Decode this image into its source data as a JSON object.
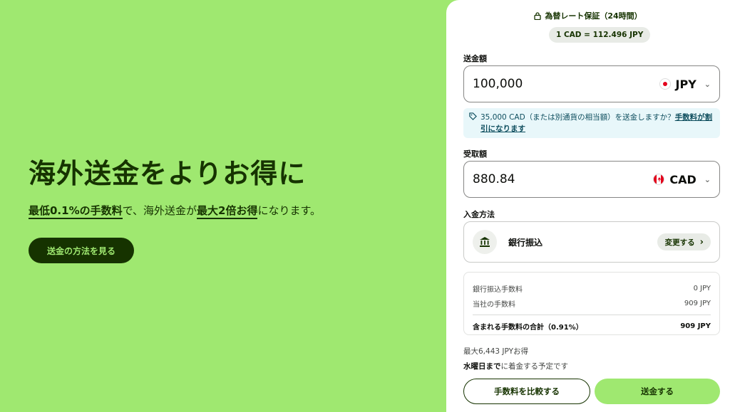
{
  "hero": {
    "title": "海外送金をよりお得に",
    "subtitle_part1": "最低0.1%の手数料",
    "subtitle_part2": "で、海外送金が",
    "subtitle_part3": "最大2倍お得",
    "subtitle_part4": "になります。",
    "cta_label": "送金の方法を見る"
  },
  "rate": {
    "guarantee_label": "為替レート保証（24時間）",
    "rate_text": "1 CAD = 112.496 JPY"
  },
  "send": {
    "label": "送金額",
    "amount": "100,000",
    "currency": "JPY"
  },
  "hint": {
    "text": "35,000 CAD（または別通貨の相当額）を送金しますか？",
    "link": "手数料が割引になります"
  },
  "receive": {
    "label": "受取額",
    "amount": "880.84",
    "currency": "CAD"
  },
  "payment": {
    "label": "入金方法",
    "method": "銀行振込",
    "change_label": "変更する"
  },
  "fees": {
    "rows": [
      {
        "label": "銀行振込手数料",
        "value": "0 JPY"
      },
      {
        "label": "当社の手数料",
        "value": "909 JPY"
      }
    ],
    "total_label": "含まれる手数料の合計（0.91%）",
    "total_value": "909 JPY"
  },
  "savings": "最大6,443 JPYお得",
  "arrival": {
    "day": "水曜日まで",
    "suffix": "に着金する予定です"
  },
  "actions": {
    "compare_label": "手数料を比較する",
    "send_label": "送金する"
  },
  "colors": {
    "brand_green": "#9fe870",
    "forest_green": "#163300",
    "hint_bg": "#e8f7fa"
  }
}
